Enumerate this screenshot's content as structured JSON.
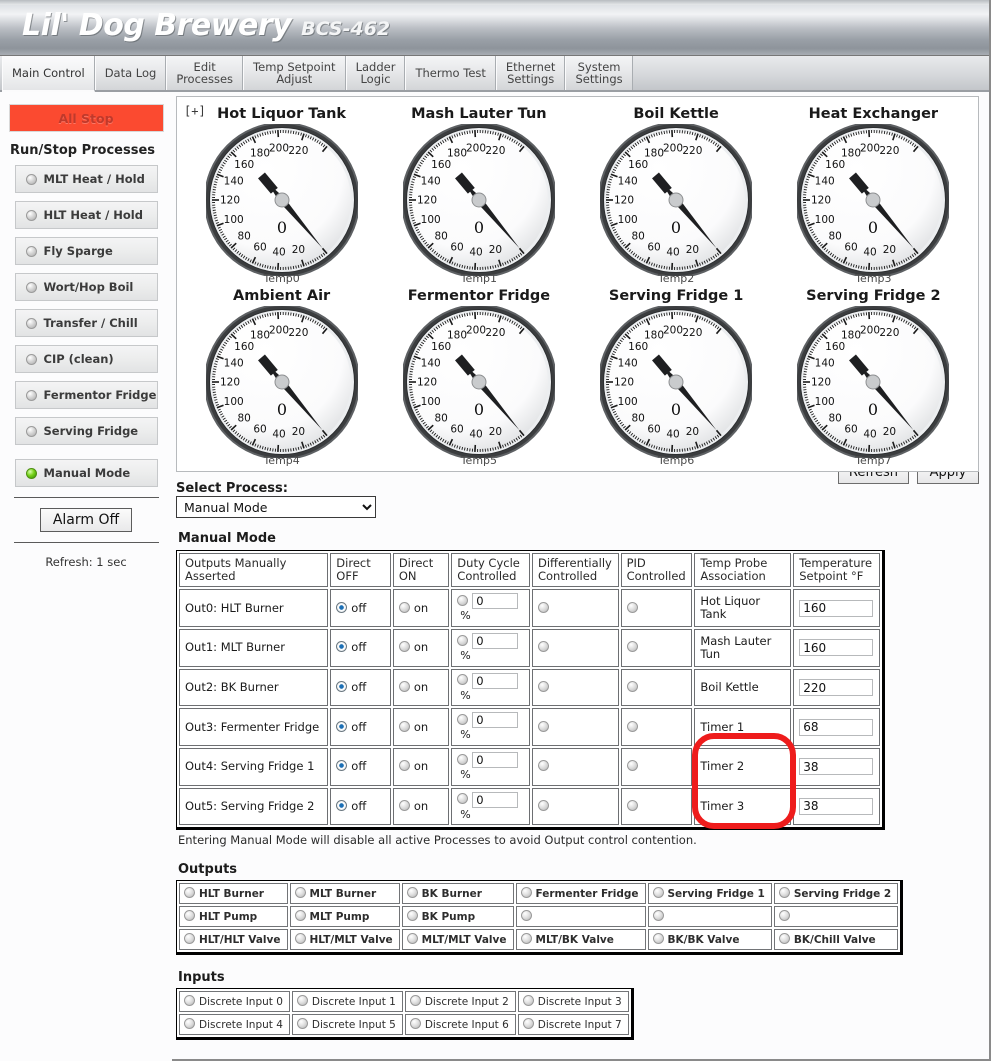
{
  "header": {
    "brand": "Lil' Dog Brewery",
    "model": "BCS-462"
  },
  "tabs": [
    {
      "label": "Main Control",
      "active": true
    },
    {
      "label": "Data Log",
      "active": false
    },
    {
      "label": "Edit\nProcesses",
      "active": false
    },
    {
      "label": "Temp Setpoint\nAdjust",
      "active": false
    },
    {
      "label": "Ladder\nLogic",
      "active": false
    },
    {
      "label": "Thermo Test",
      "active": false
    },
    {
      "label": "Ethernet\nSettings",
      "active": false
    },
    {
      "label": "System\nSettings",
      "active": false
    }
  ],
  "sidebar": {
    "all_stop": "All Stop",
    "section_title": "Run/Stop Processes",
    "processes": [
      {
        "label": "MLT Heat / Hold",
        "on": false
      },
      {
        "label": "HLT Heat / Hold",
        "on": false
      },
      {
        "label": "Fly Sparge",
        "on": false
      },
      {
        "label": "Wort/Hop Boil",
        "on": false
      },
      {
        "label": "Transfer / Chill",
        "on": false
      },
      {
        "label": "CIP (clean)",
        "on": false
      },
      {
        "label": "Fermentor Fridge",
        "on": false
      },
      {
        "label": "Serving Fridge",
        "on": false
      }
    ],
    "manual_mode": {
      "label": "Manual Mode",
      "on": true
    },
    "alarm_button": "Alarm Off",
    "refresh_note": "Refresh: 1 sec"
  },
  "gauges": {
    "expand_toggle": "[+]",
    "scale_labels": [
      "20",
      "40",
      "60",
      "80",
      "100",
      "120",
      "140",
      "160",
      "180",
      "200",
      "220"
    ],
    "zero_label": "0",
    "items": [
      {
        "title": "Hot Liquor Tank",
        "probe": "Temp0",
        "value": 0
      },
      {
        "title": "Mash Lauter Tun",
        "probe": "Temp1",
        "value": 0
      },
      {
        "title": "Boil Kettle",
        "probe": "Temp2",
        "value": 0
      },
      {
        "title": "Heat Exchanger",
        "probe": "Temp3",
        "value": 0
      },
      {
        "title": "Ambient Air",
        "probe": "Temp4",
        "value": 0
      },
      {
        "title": "Fermentor Fridge",
        "probe": "Temp5",
        "value": 0
      },
      {
        "title": "Serving Fridge 1",
        "probe": "Temp6",
        "value": 0
      },
      {
        "title": "Serving Fridge 2",
        "probe": "Temp7",
        "value": 0
      }
    ]
  },
  "select_process": {
    "label": "Select Process:",
    "selected": "Manual Mode",
    "refresh_button": "Refresh",
    "apply_button": "Apply"
  },
  "manual_mode_table": {
    "title": "Manual Mode",
    "headers": [
      "Outputs Manually Asserted",
      "Direct OFF",
      "Direct ON",
      "Duty Cycle Controlled",
      "Differentially Controlled",
      "PID Controlled",
      "Temp Probe Association",
      "Temperature Setpoint °F"
    ],
    "off_label": "off",
    "on_label": "on",
    "percent_label": "%",
    "rows": [
      {
        "name": "Out0: HLT Burner",
        "direct_off": true,
        "direct_on": false,
        "duty_selected": false,
        "duty_value": "0",
        "diff": false,
        "pid": false,
        "probe": "Hot Liquor Tank",
        "setpoint": "160"
      },
      {
        "name": "Out1: MLT Burner",
        "direct_off": true,
        "direct_on": false,
        "duty_selected": false,
        "duty_value": "0",
        "diff": false,
        "pid": false,
        "probe": "Mash Lauter Tun",
        "setpoint": "160"
      },
      {
        "name": "Out2: BK Burner",
        "direct_off": true,
        "direct_on": false,
        "duty_selected": false,
        "duty_value": "0",
        "diff": false,
        "pid": false,
        "probe": "Boil Kettle",
        "setpoint": "220"
      },
      {
        "name": "Out3: Fermenter Fridge",
        "direct_off": true,
        "direct_on": false,
        "duty_selected": false,
        "duty_value": "0",
        "diff": false,
        "pid": false,
        "probe": "Timer 1",
        "setpoint": "68"
      },
      {
        "name": "Out4: Serving Fridge 1",
        "direct_off": true,
        "direct_on": false,
        "duty_selected": false,
        "duty_value": "0",
        "diff": false,
        "pid": false,
        "probe": "Timer 2",
        "setpoint": "38"
      },
      {
        "name": "Out5: Serving Fridge 2",
        "direct_off": true,
        "direct_on": false,
        "duty_selected": false,
        "duty_value": "0",
        "diff": false,
        "pid": false,
        "probe": "Timer 3",
        "setpoint": "38"
      }
    ],
    "note": "Entering Manual Mode will disable all active Processes to avoid Output control contention."
  },
  "outputs": {
    "title": "Outputs",
    "rows": [
      [
        "HLT Burner",
        "MLT Burner",
        "BK Burner",
        "Fermenter Fridge",
        "Serving Fridge 1",
        "Serving Fridge 2"
      ],
      [
        "HLT Pump",
        "MLT Pump",
        "BK Pump",
        "",
        "",
        ""
      ],
      [
        "HLT/HLT Valve",
        "HLT/MLT Valve",
        "MLT/MLT Valve",
        "MLT/BK Valve",
        "BK/BK Valve",
        "BK/Chill Valve"
      ]
    ]
  },
  "inputs": {
    "title": "Inputs",
    "rows": [
      [
        "Discrete Input 0",
        "Discrete Input 1",
        "Discrete Input 2",
        "Discrete Input 3"
      ],
      [
        "Discrete Input 4",
        "Discrete Input 5",
        "Discrete Input 6",
        "Discrete Input 7"
      ]
    ]
  },
  "annotation": {
    "shape": "red-rounded-rectangle",
    "color": "#ee1c1c",
    "targets": [
      "Timer 1",
      "Timer 2",
      "Timer 3"
    ]
  }
}
